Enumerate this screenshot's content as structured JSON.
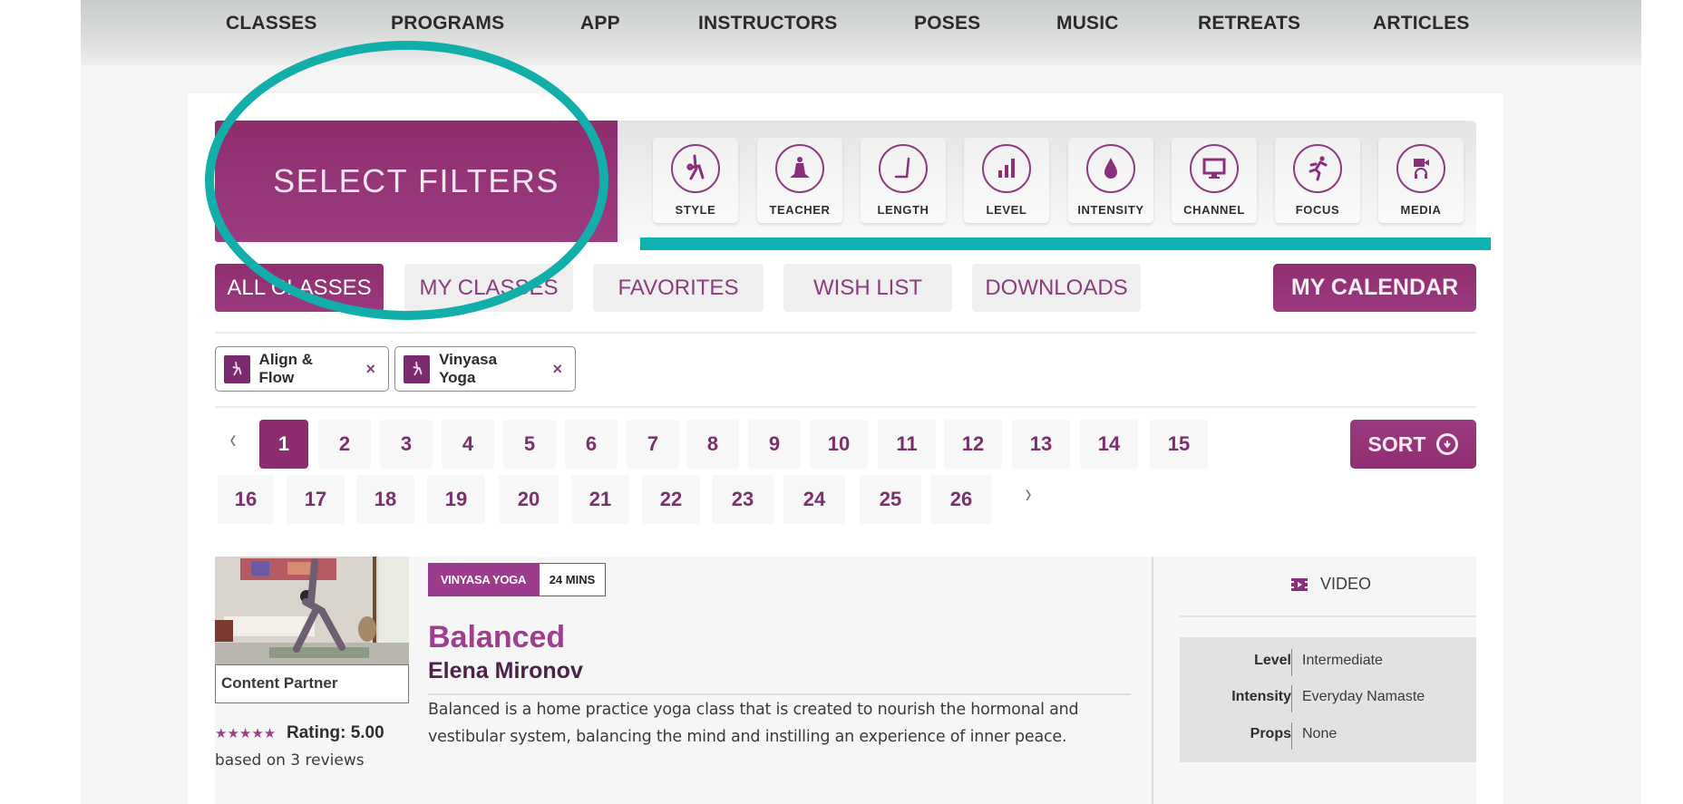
{
  "nav": {
    "items": [
      "CLASSES",
      "PROGRAMS",
      "APP",
      "INSTRUCTORS",
      "POSES",
      "MUSIC",
      "RETREATS",
      "ARTICLES"
    ]
  },
  "filters": {
    "title": "SELECT FILTERS",
    "buttons": [
      {
        "label": "STYLE",
        "icon": "yoga-pose-icon"
      },
      {
        "label": "TEACHER",
        "icon": "meditating-person-icon"
      },
      {
        "label": "LENGTH",
        "icon": "length-angle-icon"
      },
      {
        "label": "LEVEL",
        "icon": "bar-levels-icon"
      },
      {
        "label": "INTENSITY",
        "icon": "droplet-icon"
      },
      {
        "label": "CHANNEL",
        "icon": "monitor-icon"
      },
      {
        "label": "FOCUS",
        "icon": "running-person-icon"
      },
      {
        "label": "MEDIA",
        "icon": "video-headphones-icon"
      }
    ]
  },
  "tabs": {
    "items": [
      {
        "label": "ALL CLASSES",
        "active": true
      },
      {
        "label": "MY CLASSES",
        "active": false
      },
      {
        "label": "FAVORITES",
        "active": false
      },
      {
        "label": "WISH LIST",
        "active": false
      },
      {
        "label": "DOWNLOADS",
        "active": false
      }
    ],
    "calendar_label": "MY CALENDAR"
  },
  "active_filters": [
    {
      "label": "Align & Flow",
      "remove": "×"
    },
    {
      "label": "Vinyasa Yoga",
      "remove": "×"
    }
  ],
  "pagination": {
    "prev": "‹",
    "next": "›",
    "current": 1,
    "pages": [
      "1",
      "2",
      "3",
      "4",
      "5",
      "6",
      "7",
      "8",
      "9",
      "10",
      "11",
      "12",
      "13",
      "14",
      "15",
      "16",
      "17",
      "18",
      "19",
      "20",
      "21",
      "22",
      "23",
      "24",
      "25",
      "26"
    ]
  },
  "sort": {
    "label": "SORT"
  },
  "class_card": {
    "style_tag": "VINYASA YOGA",
    "length_tag": "24 MINS",
    "title": "Balanced",
    "teacher": "Elena Mironov",
    "description": "Balanced is a home practice yoga class that is created to nourish the hormonal and vestibular system, balancing the mind and instilling an experience of inner peace.",
    "partner_label": "Content Partner",
    "stars": "★★★★★",
    "rating_label": "Rating: 5.00",
    "reviews_label": "based on 3 reviews",
    "media_type": "VIDEO",
    "meta": [
      {
        "key": "Level",
        "value": "Intermediate"
      },
      {
        "key": "Intensity",
        "value": "Everyday Namaste"
      },
      {
        "key": "Props",
        "value": "None"
      }
    ]
  },
  "colors": {
    "brand_purple": "#8f2d6f",
    "accent_purple": "#9c3a8c",
    "annotation_teal": "#12aeaa"
  }
}
